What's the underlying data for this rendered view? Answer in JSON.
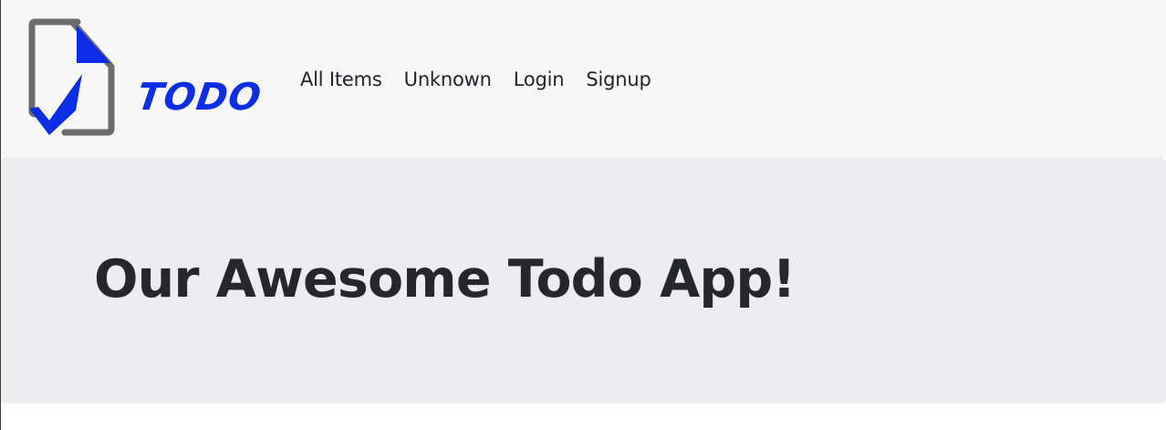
{
  "brand": {
    "logo_text": "TODO",
    "icon": "document-checkmark-icon",
    "colors": {
      "accent": "#0a2ee8",
      "document_outline": "#6b6b6b"
    }
  },
  "nav": {
    "links": [
      {
        "label": "All Items"
      },
      {
        "label": "Unknown"
      },
      {
        "label": "Login"
      },
      {
        "label": "Signup"
      }
    ]
  },
  "hero": {
    "title": "Our Awesome Todo App!"
  },
  "colors": {
    "navbar_bg": "#f7f7f8",
    "hero_bg": "#ededef",
    "text": "#212529"
  }
}
